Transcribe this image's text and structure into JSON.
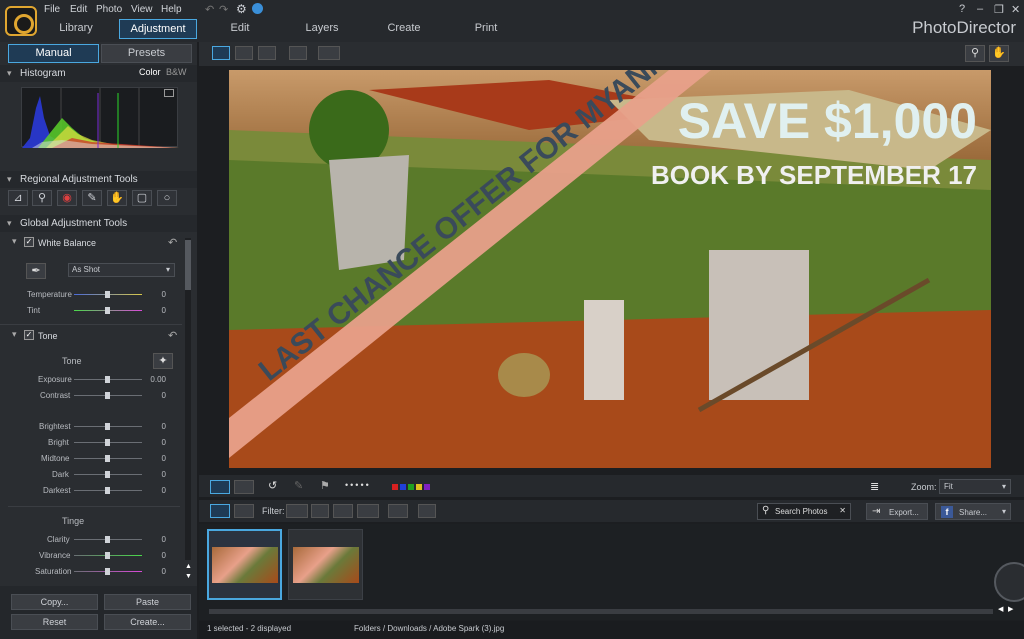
{
  "app": {
    "brand": "PhotoDirector"
  },
  "menu": [
    "File",
    "Edit",
    "Photo",
    "View",
    "Help"
  ],
  "tabs": [
    "Library",
    "Adjustment",
    "Edit",
    "Layers",
    "Create",
    "Print"
  ],
  "active_tab": "Adjustment",
  "left": {
    "subtabs": [
      "Manual",
      "Presets"
    ],
    "histogram": {
      "title": "Histogram",
      "color": "Color",
      "bw": "B&W"
    },
    "regional": {
      "title": "Regional Adjustment Tools"
    },
    "global": {
      "title": "Global Adjustment Tools"
    },
    "white_balance": {
      "title": "White Balance",
      "preset": "As Shot",
      "sliders": [
        {
          "label": "Temperature",
          "value": "0"
        },
        {
          "label": "Tint",
          "value": "0"
        }
      ]
    },
    "tone": {
      "title": "Tone",
      "tone_label": "Tone",
      "sliders_a": [
        {
          "label": "Exposure",
          "value": "0.00"
        },
        {
          "label": "Contrast",
          "value": "0"
        }
      ],
      "sliders_b": [
        {
          "label": "Brightest",
          "value": "0"
        },
        {
          "label": "Bright",
          "value": "0"
        },
        {
          "label": "Midtone",
          "value": "0"
        },
        {
          "label": "Dark",
          "value": "0"
        },
        {
          "label": "Darkest",
          "value": "0"
        }
      ],
      "tinge_label": "Tinge",
      "sliders_c": [
        {
          "label": "Clarity",
          "value": "0"
        },
        {
          "label": "Vibrance",
          "value": "0"
        },
        {
          "label": "Saturation",
          "value": "0"
        }
      ]
    },
    "buttons": {
      "copy": "Copy...",
      "paste": "Paste",
      "reset": "Reset",
      "create": "Create..."
    }
  },
  "photo": {
    "banner": "LAST CHANCE OFFER FOR MYANMAR",
    "headline": "SAVE $1,000",
    "subline": "BOOK BY SEPTEMBER 17"
  },
  "strip": {
    "zoom_label": "Zoom:",
    "zoom_value": "Fit",
    "filter_label": "Filter:",
    "search_placeholder": "Search Photos",
    "export_label": "Export...",
    "share_label": "Share..."
  },
  "status": {
    "selection": "1 selected - 2 displayed",
    "path": "Folders / Downloads / Adobe Spark (3).jpg"
  },
  "colors": {
    "accent": "#4aa8e0",
    "banner": "#e8a08a",
    "headline": "#e0f0f0"
  }
}
